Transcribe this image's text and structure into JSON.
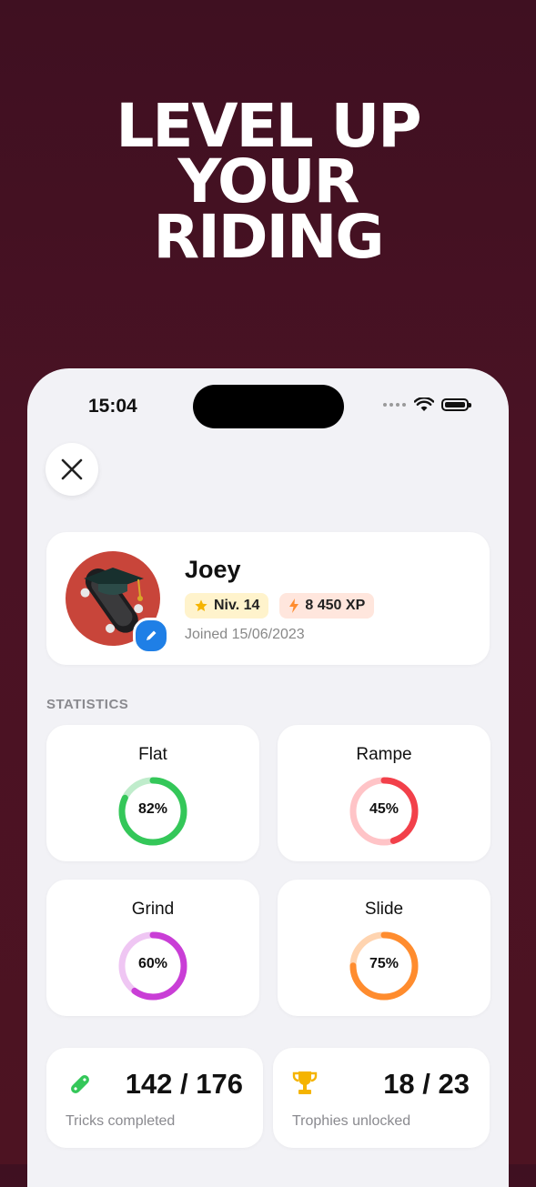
{
  "hero": {
    "line1": "LEVEL UP",
    "line2": "YOUR",
    "line3": "RIDING"
  },
  "status_bar": {
    "time": "15:04"
  },
  "profile": {
    "name": "Joey",
    "level": "Niv. 14",
    "xp": "8 450 XP",
    "joined": "Joined 15/06/2023"
  },
  "statistics": {
    "title": "STATISTICS",
    "items": [
      {
        "label": "Flat",
        "percent_text": "82%",
        "value": 82,
        "color": "#34c759",
        "track": "#bfeccb"
      },
      {
        "label": "Rampe",
        "percent_text": "45%",
        "value": 45,
        "color": "#f2404a",
        "track": "#ffc4c7"
      },
      {
        "label": "Grind",
        "percent_text": "60%",
        "value": 60,
        "color": "#c93ed6",
        "track": "#efc6f3"
      },
      {
        "label": "Slide",
        "percent_text": "75%",
        "value": 75,
        "color": "#ff8c2e",
        "track": "#ffd4b0"
      }
    ]
  },
  "tricks": {
    "value": "142 / 176",
    "caption": "Tricks completed",
    "icon": "skateboard-icon",
    "color": "#34c759"
  },
  "trophies": {
    "value": "18 / 23",
    "caption": "Trophies unlocked",
    "icon": "trophy-icon",
    "color": "#f5b400"
  }
}
